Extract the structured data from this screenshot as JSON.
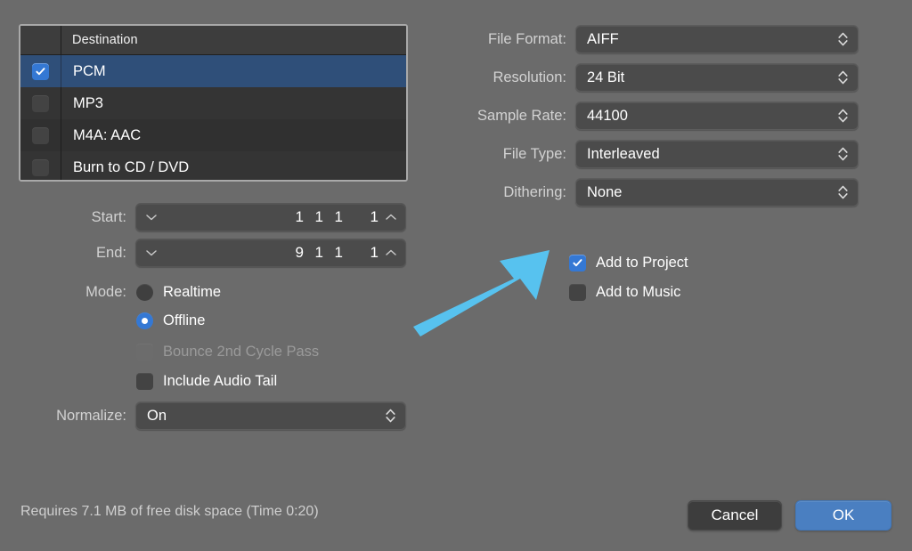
{
  "dialog": {
    "background_color": "#6b6b6b",
    "accent_color": "#3478d4",
    "annotation_arrow_color": "#57c2ef"
  },
  "destination_list": {
    "header": {
      "check_column": "",
      "name_column": "Destination"
    },
    "rows": [
      {
        "label": "PCM",
        "checked": true,
        "selected": true
      },
      {
        "label": "MP3",
        "checked": false,
        "selected": false
      },
      {
        "label": "M4A: AAC",
        "checked": false,
        "selected": false
      },
      {
        "label": "Burn to CD / DVD",
        "checked": false,
        "selected": false
      }
    ]
  },
  "format_settings": {
    "file_format": {
      "label": "File Format:",
      "value": "AIFF"
    },
    "resolution": {
      "label": "Resolution:",
      "value": "24 Bit"
    },
    "sample_rate": {
      "label": "Sample Rate:",
      "value": "44100"
    },
    "file_type": {
      "label": "File Type:",
      "value": "Interleaved"
    },
    "dithering": {
      "label": "Dithering:",
      "value": "None"
    }
  },
  "range": {
    "start": {
      "label": "Start:",
      "bars": "1",
      "beats": "1",
      "divisions": "1",
      "ticks": "1"
    },
    "end": {
      "label": "End:",
      "bars": "9",
      "beats": "1",
      "divisions": "1",
      "ticks": "1"
    }
  },
  "mode": {
    "label": "Mode:",
    "options": [
      {
        "label": "Realtime",
        "selected": false
      },
      {
        "label": "Offline",
        "selected": true
      }
    ],
    "checkboxes": [
      {
        "label": "Bounce 2nd Cycle Pass",
        "checked": false,
        "disabled": true
      },
      {
        "label": "Include Audio Tail",
        "checked": false,
        "disabled": false
      }
    ]
  },
  "normalize": {
    "label": "Normalize:",
    "value": "On"
  },
  "destinations_extra": [
    {
      "label": "Add to Project",
      "checked": true
    },
    {
      "label": "Add to Music",
      "checked": false
    }
  ],
  "footer": {
    "status": "Requires 7.1 MB of free disk space  (Time 0:20)",
    "cancel_label": "Cancel",
    "ok_label": "OK"
  }
}
